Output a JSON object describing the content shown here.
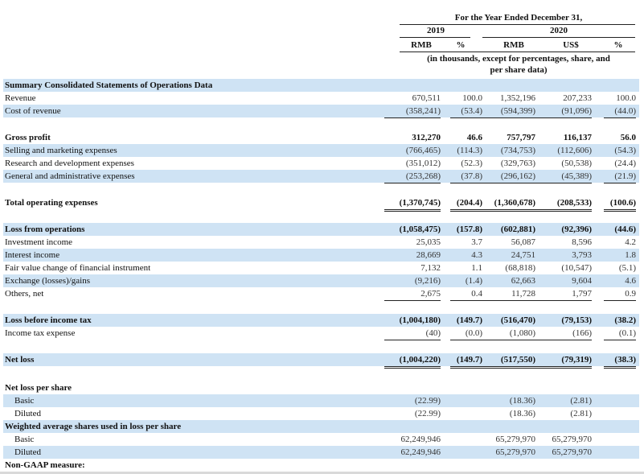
{
  "header": {
    "period": "For the Year Ended December 31,",
    "year_2019": "2019",
    "year_2020": "2020",
    "col_rmb_2019": "RMB",
    "col_pct_2019": "%",
    "col_rmb_2020": "RMB",
    "col_usd_2020": "US$",
    "col_pct_2020": "%",
    "note_line1": "(in thousands, except for percentages, share, and",
    "note_line2": "per share data)"
  },
  "rows": [
    {
      "label": "Summary Consolidated Statements of Operations Data",
      "bold": true,
      "shaded": true
    },
    {
      "label": "Revenue",
      "values": [
        "670,511",
        "100.0",
        "1,352,196",
        "207,233",
        "100.0"
      ]
    },
    {
      "label": "Cost of revenue",
      "shaded": true,
      "values": [
        "(358,241)",
        "(53.4)",
        "(594,399)",
        "(91,096)",
        "(44.0)"
      ]
    },
    {
      "label": "Gross profit",
      "bold": true,
      "values": [
        "312,270",
        "46.6",
        "757,797",
        "116,137",
        "56.0"
      ]
    },
    {
      "label": "Selling and marketing expenses",
      "shaded": true,
      "values": [
        "(766,465)",
        "(114.3)",
        "(734,753)",
        "(112,606)",
        "(54.3)"
      ]
    },
    {
      "label": "Research and development expenses",
      "values": [
        "(351,012)",
        "(52.3)",
        "(329,763)",
        "(50,538)",
        "(24.4)"
      ]
    },
    {
      "label": "General and administrative expenses",
      "shaded": true,
      "values": [
        "(253,268)",
        "(37.8)",
        "(296,162)",
        "(45,389)",
        "(21.9)"
      ]
    },
    {
      "label": "Total operating expenses",
      "bold": true,
      "values": [
        "(1,370,745)",
        "(204.4)",
        "(1,360,678)",
        "(208,533)",
        "(100.6)"
      ]
    },
    {
      "label": "Loss from operations",
      "bold": true,
      "shaded": true,
      "values": [
        "(1,058,475)",
        "(157.8)",
        "(602,881)",
        "(92,396)",
        "(44.6)"
      ]
    },
    {
      "label": "Investment income",
      "values": [
        "25,035",
        "3.7",
        "56,087",
        "8,596",
        "4.2"
      ]
    },
    {
      "label": "Interest income",
      "shaded": true,
      "values": [
        "28,669",
        "4.3",
        "24,751",
        "3,793",
        "1.8"
      ]
    },
    {
      "label": "Fair value change of financial instrument",
      "values": [
        "7,132",
        "1.1",
        "(68,818)",
        "(10,547)",
        "(5.1)"
      ]
    },
    {
      "label": "Exchange (losses)/gains",
      "shaded": true,
      "values": [
        "(9,216)",
        "(1.4)",
        "62,663",
        "9,604",
        "4.6"
      ]
    },
    {
      "label": "Others, net",
      "values": [
        "2,675",
        "0.4",
        "11,728",
        "1,797",
        "0.9"
      ]
    },
    {
      "label": "Loss before income tax",
      "bold": true,
      "shaded": true,
      "values": [
        "(1,004,180)",
        "(149.7)",
        "(516,470)",
        "(79,153)",
        "(38.2)"
      ]
    },
    {
      "label": "Income tax expense",
      "values": [
        "(40)",
        "(0.0)",
        "(1,080)",
        "(166)",
        "(0.1)"
      ]
    },
    {
      "label": "Net loss",
      "bold": true,
      "shaded": true,
      "values": [
        "(1,004,220)",
        "(149.7)",
        "(517,550)",
        "(79,319)",
        "(38.3)"
      ]
    },
    {
      "label": "Net loss per share",
      "bold": true
    },
    {
      "label": "Basic",
      "indent": true,
      "shaded": true,
      "values": [
        "(22.99)",
        "",
        "(18.36)",
        "(2.81)",
        ""
      ]
    },
    {
      "label": "Diluted",
      "indent": true,
      "values": [
        "(22.99)",
        "",
        "(18.36)",
        "(2.81)",
        ""
      ]
    },
    {
      "label": "Weighted average shares used in loss per share",
      "bold": true,
      "shaded": true
    },
    {
      "label": "Basic",
      "indent": true,
      "values": [
        "62,249,946",
        "",
        "65,279,970",
        "65,279,970",
        ""
      ]
    },
    {
      "label": "Diluted",
      "indent": true,
      "shaded": true,
      "values": [
        "62,249,946",
        "",
        "65,279,970",
        "65,279,970",
        ""
      ]
    },
    {
      "label": "Non-GAAP measure:",
      "bold": true
    }
  ]
}
